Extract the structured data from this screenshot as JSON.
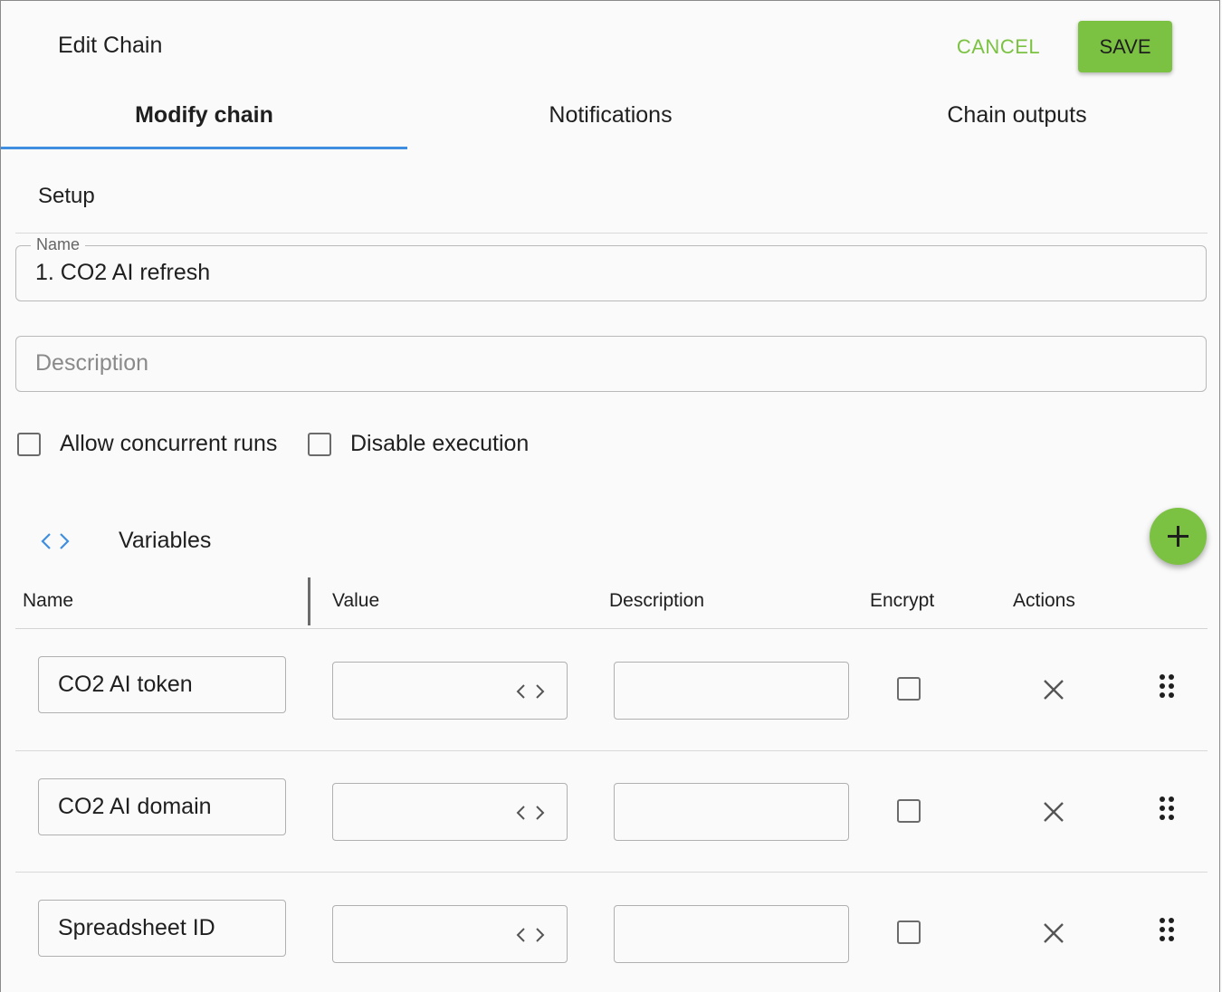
{
  "header": {
    "title": "Edit Chain",
    "cancel_label": "CANCEL",
    "save_label": "SAVE"
  },
  "tabs": [
    {
      "label": "Modify chain",
      "active": true
    },
    {
      "label": "Notifications",
      "active": false
    },
    {
      "label": "Chain outputs",
      "active": false
    }
  ],
  "setup": {
    "section_title": "Setup",
    "name_label": "Name",
    "name_value": "1. CO2 AI refresh",
    "description_placeholder": "Description",
    "allow_concurrent_label": "Allow concurrent runs",
    "disable_execution_label": "Disable execution"
  },
  "variables": {
    "title": "Variables",
    "columns": [
      "Name",
      "Value",
      "Description",
      "Encrypt",
      "Actions"
    ],
    "rows": [
      {
        "name": "CO2 AI token",
        "value": "",
        "description": "",
        "encrypt": false
      },
      {
        "name": "CO2 AI domain",
        "value": "",
        "description": "",
        "encrypt": false
      },
      {
        "name": "Spreadsheet ID",
        "value": "",
        "description": "",
        "encrypt": false
      }
    ]
  },
  "colors": {
    "accent": "#7cc242",
    "tab_indicator": "#3f8ee0",
    "code_icon": "#3f8ee0"
  },
  "icons": [
    "code-brackets-icon",
    "plus-icon",
    "close-icon",
    "drag-handle-icon"
  ]
}
